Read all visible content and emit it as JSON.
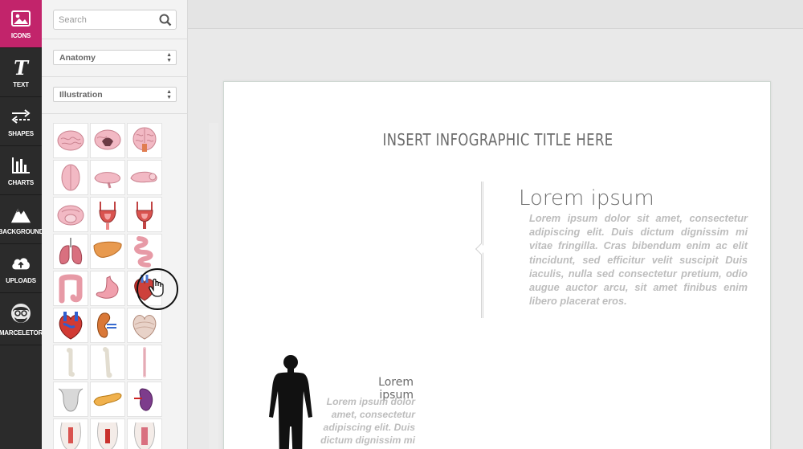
{
  "rail": {
    "items": [
      {
        "label": "ICONS",
        "icon": "image-icon"
      },
      {
        "label": "TEXT",
        "icon": "text-t-icon"
      },
      {
        "label": "SHAPES",
        "icon": "arrows-swap-icon"
      },
      {
        "label": "CHARTS",
        "icon": "bar-chart-icon"
      },
      {
        "label": "BACKGROUND",
        "icon": "mountains-icon"
      },
      {
        "label": "UPLOADS",
        "icon": "cloud-upload-icon"
      },
      {
        "label": "MARCELETOR",
        "icon": "user-avatar-icon"
      }
    ],
    "active_color": "#c2246b"
  },
  "panel": {
    "search_placeholder": "Search",
    "category_select": "Anatomy",
    "style_select": "Illustration",
    "icon_tiles": [
      "brain-side",
      "brain-section",
      "brain-back",
      "brain-top",
      "brain-profile",
      "brain-lateral",
      "brain-bottom",
      "bladder-male",
      "bladder-female",
      "lungs",
      "liver",
      "small-intestine",
      "large-intestine",
      "stomach",
      "heart-small",
      "heart-anatomy",
      "kidney",
      "heart-hovered",
      "bone-long",
      "bone-femur",
      "bone-slim",
      "thyroid",
      "pancreas",
      "spleen",
      "torso-organs-1",
      "torso-organs-2",
      "torso-organs-3"
    ]
  },
  "canvas": {
    "infographic_title": "INSERT INFOGRAPHIC TITLE HERE",
    "block1": {
      "heading": "Lorem ipsum",
      "body": "Lorem ipsum dolor sit amet, consectetur adipiscing elit. Duis dictum dignissim mi vitae fringilla. Cras bibendum enim ac elit tincidunt, sed efficitur velit suscipit Duis iaculis, nulla sed consectetur pretium, odio augue auctor arcu, sit amet finibus enim libero placerat eros."
    },
    "block2": {
      "heading": "Lorem ipsum",
      "body": "Lorem ipsum dolor amet, consectetur adipiscing elit. Duis dictum dignissim mi"
    }
  }
}
